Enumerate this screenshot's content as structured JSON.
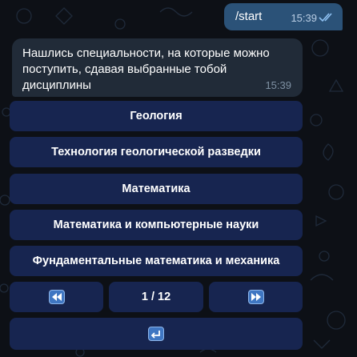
{
  "chat": {
    "outgoing": {
      "text": "/start",
      "time": "15:39",
      "status_icon": "double-check-icon"
    },
    "incoming": {
      "text": "Нашлись специальности, на которые можно поступить, сдавая выбранные тобой дисциплины",
      "time": "15:39"
    }
  },
  "keyboard": {
    "rows": [
      {
        "label": "Геология"
      },
      {
        "label": "Технология геологической разведки"
      },
      {
        "label": "Математика"
      },
      {
        "label": "Математика и компьютерные науки"
      },
      {
        "label": "Фундаментальные математика и механика"
      }
    ],
    "pagination": {
      "prev_icon": "rewind-icon",
      "page": "1 / 12",
      "next_icon": "fast-forward-icon"
    },
    "back_icon": "return-arrow-icon"
  },
  "colors": {
    "background": "#0d1016",
    "outgoing_bubble": "#2b5278",
    "incoming_bubble": "#212b38",
    "keyboard_button": "#172550",
    "emoji_blue": "#3f76c2"
  }
}
